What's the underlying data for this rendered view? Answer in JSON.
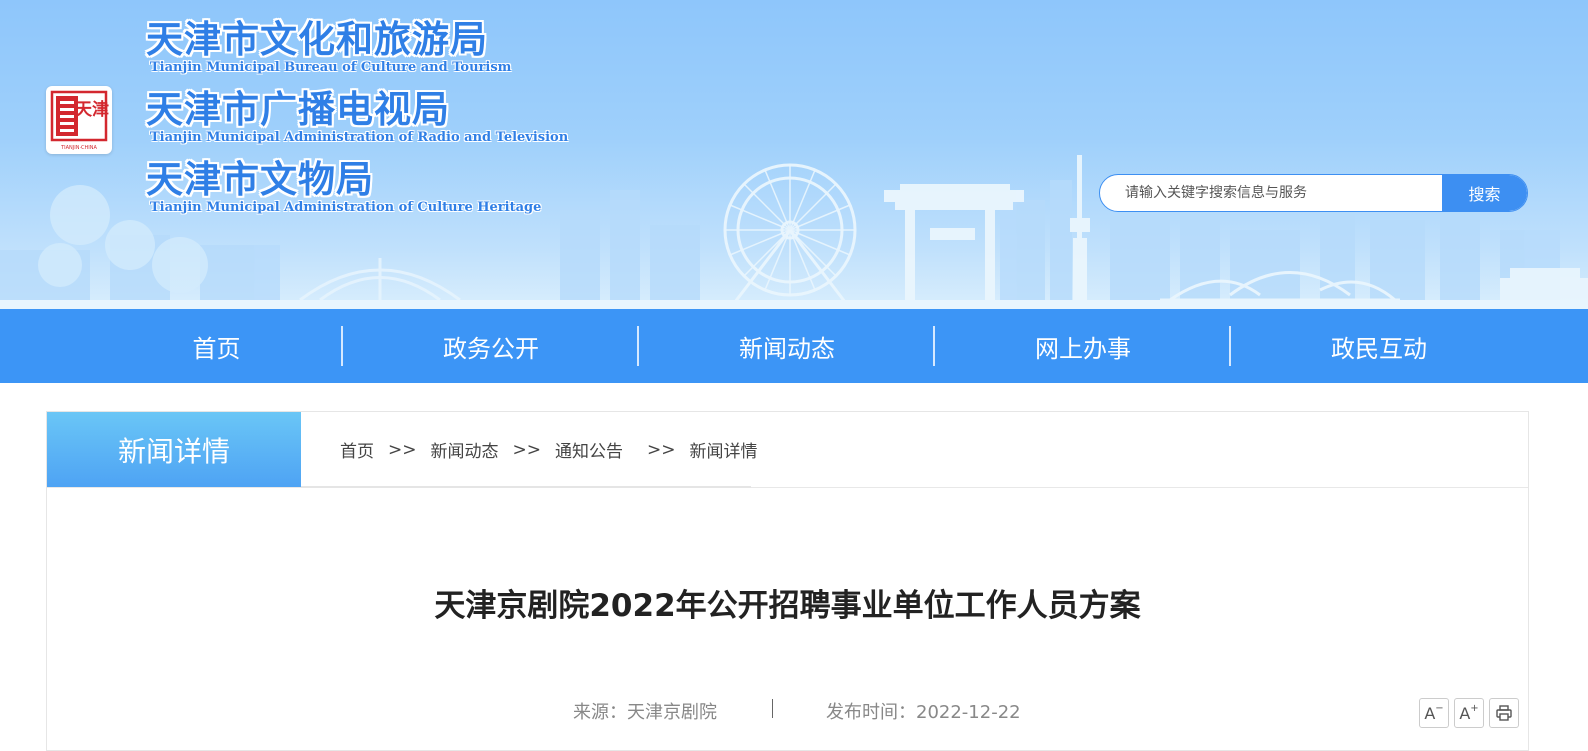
{
  "header": {
    "logo": {
      "text": "天津",
      "caption": "TIANJIN·CHINA"
    },
    "titles": [
      {
        "cn": "天津市文化和旅游局",
        "en": "Tianjin Municipal Bureau of Culture and Tourism"
      },
      {
        "cn": "天津市广播电视局",
        "en": "Tianjin Municipal Administration of Radio and Television"
      },
      {
        "cn": "天津市文物局",
        "en": "Tianjin Municipal Administration of Culture Heritage"
      }
    ],
    "search": {
      "placeholder": "请输入关键字搜索信息与服务",
      "button_label": "搜索"
    }
  },
  "nav": {
    "items": [
      {
        "label": "首页"
      },
      {
        "label": "政务公开"
      },
      {
        "label": "新闻动态"
      },
      {
        "label": "网上办事"
      },
      {
        "label": "政民互动"
      }
    ]
  },
  "section": {
    "title": "新闻详情"
  },
  "breadcrumb": {
    "items": [
      "首页",
      "新闻动态",
      "通知公告",
      "新闻详情"
    ],
    "separator": ">>"
  },
  "article": {
    "title": "天津京剧院2022年公开招聘事业单位工作人员方案",
    "source": "来源：天津京剧院",
    "published": "发布时间：2022-12-22"
  },
  "tools": {
    "font_decrease": "A",
    "font_increase": "A",
    "decrease_mark": "−",
    "increase_mark": "+"
  },
  "colors": {
    "nav_bg": "#3c95f6",
    "brand_blue": "#2f7fe6",
    "search_button": "#3d8ff2",
    "section_tab_top": "#6ac6f6",
    "section_tab_bottom": "#4ea3f4"
  }
}
